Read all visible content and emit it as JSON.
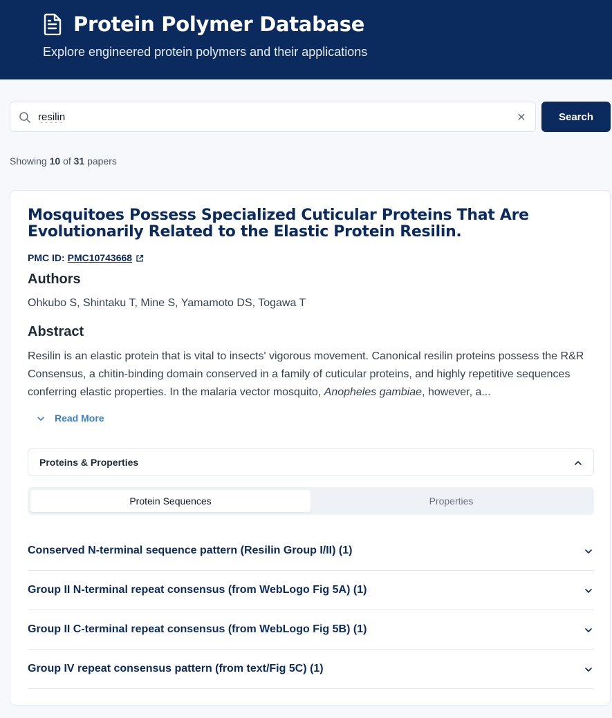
{
  "header": {
    "icon": "document-icon",
    "title": "Protein Polymer Database",
    "subtitle": "Explore engineered protein polymers and their applications"
  },
  "search": {
    "value": "resilin",
    "placeholder": "",
    "button_label": "Search",
    "clear_glyph": "✕"
  },
  "results": {
    "prefix": "Showing",
    "shown": "10",
    "of": "of",
    "total": "31",
    "suffix": "papers"
  },
  "paper": {
    "title": "Mosquitoes Possess Specialized Cuticular Proteins That Are Evolutionarily Related to the Elastic Protein Resilin.",
    "pmc_label": "PMC ID:",
    "pmc_id": "PMC10743668",
    "authors_heading": "Authors",
    "authors": "Ohkubo S, Shintaku T, Mine S, Yamamoto DS, Togawa T",
    "abstract_heading": "Abstract",
    "abstract_part1": "Resilin is an elastic protein that is vital to insects' vigorous movement. Canonical resilin proteins possess the R&R Consensus, a chitin-binding domain conserved in a family of cuticular proteins, and highly repetitive sequences conferring elastic properties. In the malaria vector mosquito, ",
    "abstract_italic": "Anopheles gambiae",
    "abstract_part2": ", however, a...",
    "read_more": "Read More"
  },
  "proteins_section": {
    "label": "Proteins & Properties",
    "tabs": [
      {
        "label": "Protein Sequences",
        "active": true
      },
      {
        "label": "Properties",
        "active": false
      }
    ],
    "sequences": [
      {
        "label": "Conserved N-terminal sequence pattern (Resilin Group I/II) (1)"
      },
      {
        "label": "Group II N-terminal repeat consensus (from WebLogo Fig 5A) (1)"
      },
      {
        "label": "Group II C-terminal repeat consensus (from WebLogo Fig 5B) (1)"
      },
      {
        "label": "Group IV repeat consensus pattern (from text/Fig 5C) (1)"
      }
    ]
  },
  "colors": {
    "brand": "#0b2a5e",
    "link": "#3b82c4",
    "background": "#f6f8fb"
  }
}
